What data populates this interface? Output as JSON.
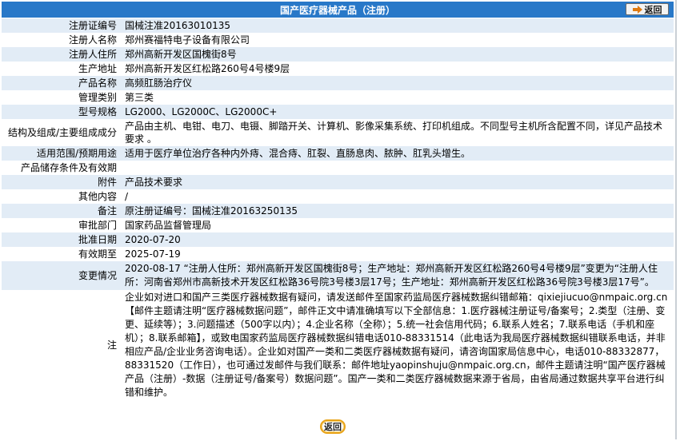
{
  "header": {
    "title": "国产医疗器械产品（注册）",
    "back_label": "返回"
  },
  "colors": {
    "header_bg": "#2878c8",
    "row_alt": "#e2ecf6",
    "back_ring": "#e8a317"
  },
  "rows": [
    {
      "label": "注册证编号",
      "value": "国械注准20163010135"
    },
    {
      "label": "注册人名称",
      "value": "郑州赛福特电子设备有限公司"
    },
    {
      "label": "注册人住所",
      "value": "郑州高新开发区国槐街8号"
    },
    {
      "label": "生产地址",
      "value": "郑州高新开发区红松路260号4号楼9层"
    },
    {
      "label": "产品名称",
      "value": "高频肛肠治疗仪"
    },
    {
      "label": "管理类别",
      "value": "第三类"
    },
    {
      "label": "型号规格",
      "value": "LG2000、LG2000C、LG2000C+"
    },
    {
      "label": "结构及组成/主要组成成分",
      "value": "产品由主机、电钳、电刀、电镊、脚踏开关、计算机、影像采集系统、打印机组成。不同型号主机所含配置不同，详见产品技术要求 。"
    },
    {
      "label": "适用范围/预期用途",
      "value": "适用于医疗单位治疗各种内外痔、混合痔、肛裂、直肠息肉、脓肿、肛乳头增生。"
    },
    {
      "label": "产品储存条件及有效期",
      "value": ""
    },
    {
      "label": "附件",
      "value": "产品技术要求"
    },
    {
      "label": "其他内容",
      "value": "/"
    },
    {
      "label": "备注",
      "value": "原注册证编号：国械注准20163250135"
    },
    {
      "label": "审批部门",
      "value": "国家药品监督管理局"
    },
    {
      "label": "批准日期",
      "value": "2020-07-20"
    },
    {
      "label": "有效期至",
      "value": "2025-07-19"
    },
    {
      "label": "变更情况",
      "value": "2020-08-17 “注册人住所：郑州高新开发区国槐街8号；生产地址：郑州高新开发区红松路260号4号楼9层”变更为“注册人住所：河南省郑州市高新技术开发区红松路36号院3号楼3层17号；生产地址：郑州高新开发区红松路36号院3号楼3层17号”。"
    },
    {
      "label": "注",
      "value": "企业如对进口和国产三类医疗器械数据有疑问，请发送邮件至国家药监局医疗器械数据纠错邮箱：qixiejiucuo@nmpaic.org.cn【邮件主题请注明“医疗器械数据问题”，邮件正文中请准确填写以下全部信息：1.医疗器械注册证号/备案号；2.类型（注册、变更、延续等）；3.问题描述（500字以内）；4.企业名称（全称）；5.统一社会信用代码；6.联系人姓名；7.联系电话（手机和座机）；8.联系邮箱】，或致电国家药监局医疗器械数据纠错电话010-88331514（此电话为我局医疗器械数据纠错联系电话，并非相应产品/企业业务咨询电话）。企业如对国产一类和二类医疗器械数据有疑问，请咨询国家局信息中心，电话010-88332877，88331520（工作日），也可通过发邮件与我们联系：邮件地址yaopinshuju@nmpaic.org.cn，邮件主题请注明“国产医疗器械产品（注册）-数据（注册证号/备案号）数据问题”。国产一类和二类医疗器械数据来源于省局，由省局通过数据共享平台进行纠错和维护。"
    }
  ],
  "footer": {
    "back_label": "返回"
  }
}
